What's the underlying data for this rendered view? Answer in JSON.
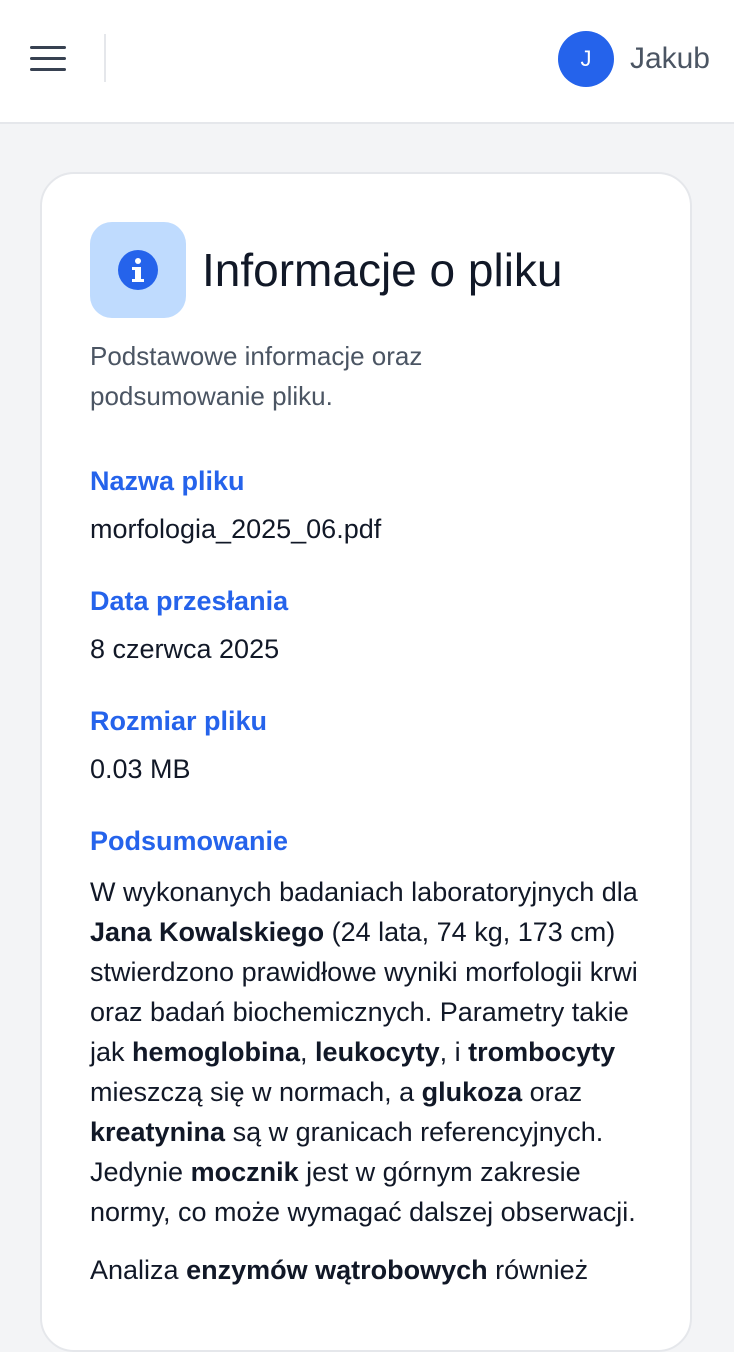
{
  "header": {
    "user_initial": "J",
    "user_name": "Jakub",
    "menu_icon": "menu-icon"
  },
  "card": {
    "icon": "info-icon",
    "title": "Informacje o pliku",
    "subtitle": "Podstawowe informacje oraz podsumowanie pliku.",
    "fields": [
      {
        "label": "Nazwa pliku",
        "value": "morfologia_2025_06.pdf"
      },
      {
        "label": "Data przesłania",
        "value": "8 czerwca 2025"
      },
      {
        "label": "Rozmiar pliku",
        "value": "0.03 MB"
      }
    ],
    "summary": {
      "label": "Podsumowanie",
      "p1": [
        {
          "t": "W wykonanych badaniach laboratoryjnych dla ",
          "b": false
        },
        {
          "t": "Jana Kowalskiego",
          "b": true
        },
        {
          "t": " (24 lata, 74 kg, 173 cm) stwierdzono prawidłowe wyniki morfologii krwi oraz badań biochemicznych. Parametry takie jak ",
          "b": false
        },
        {
          "t": "hemoglobina",
          "b": true
        },
        {
          "t": ", ",
          "b": false
        },
        {
          "t": "leukocyty",
          "b": true
        },
        {
          "t": ", i ",
          "b": false
        },
        {
          "t": "trombocyty",
          "b": true
        },
        {
          "t": " mieszczą się w normach, a ",
          "b": false
        },
        {
          "t": "glukoza",
          "b": true
        },
        {
          "t": " oraz ",
          "b": false
        },
        {
          "t": "kreatynina",
          "b": true
        },
        {
          "t": " są w granicach referencyjnych. Jedynie ",
          "b": false
        },
        {
          "t": "mocznik",
          "b": true
        },
        {
          "t": " jest w górnym zakresie normy, co może wymagać dalszej obserwacji.",
          "b": false
        }
      ],
      "p2": [
        {
          "t": "Analiza ",
          "b": false
        },
        {
          "t": "enzymów wątrobowych",
          "b": true
        },
        {
          "t": " również",
          "b": false
        }
      ]
    }
  },
  "colors": {
    "accent": "#2563eb",
    "icon_bg": "#bfdbfe",
    "page_bg": "#f3f4f6"
  }
}
